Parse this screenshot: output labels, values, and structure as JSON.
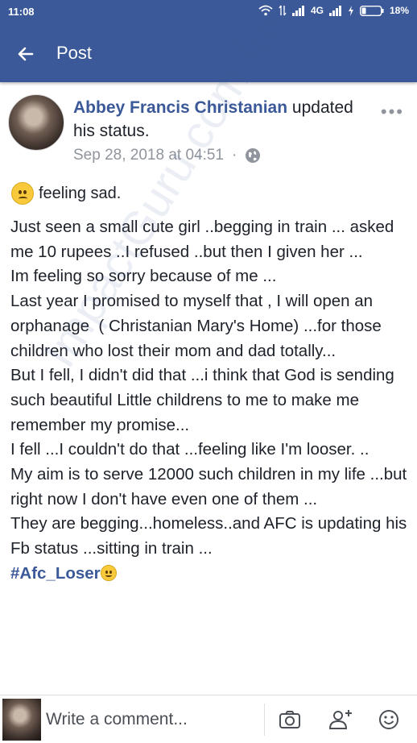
{
  "status_bar": {
    "time": "11:08",
    "network": "4G",
    "battery": "18%"
  },
  "appbar": {
    "back_icon": "arrow-left-icon",
    "title": "Post"
  },
  "post": {
    "author": "Abbey Francis Christanian",
    "action": " updated his status.",
    "timestamp": "Sep 28, 2018 at 04:51",
    "separator": "·",
    "privacy_icon": "globe-icon",
    "more_icon": "more-dots-icon",
    "feeling_label": "feeling sad.",
    "body_lines": [
      "Just seen a small cute girl ..begging in train ... asked me 10 rupees ..I refused ..but then I given her ...",
      "Im feeling so sorry because of me ...",
      "Last year I promised to myself that , I will open an orphanage  ( Christanian Mary's Home) ...for those children who lost their mom and dad totally...",
      "But I fell, I didn't did that ...i think that God is sending such beautiful Little childrens to me to make me remember my promise...",
      "I fell ...I couldn't do that ...feeling like I'm looser. ..",
      "My aim is to serve 12000 such children in my life ...but right now I don't have even one of them ...",
      "They are begging...homeless..and AFC is updating his Fb status ...sitting in train ..."
    ],
    "hashtag": "#Afc_Loser",
    "watermark": "ImpactGuru.com/fundraiser/1564..."
  },
  "comment_bar": {
    "placeholder": "Write a comment...",
    "camera_icon": "camera-icon",
    "tag_icon": "tag-friend-icon",
    "emoji_icon": "emoji-icon"
  },
  "colors": {
    "brand": "#3b5998",
    "meta_gray": "#90949c",
    "text": "#1d2129"
  }
}
